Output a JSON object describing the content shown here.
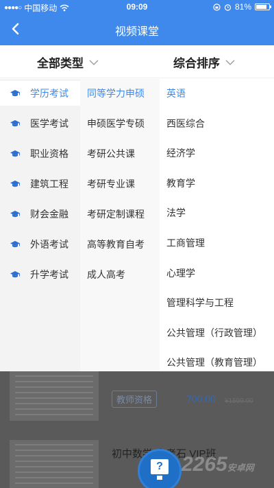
{
  "status_bar": {
    "carrier": "中国移动",
    "time": "09:09",
    "battery": "81%"
  },
  "nav": {
    "title": "视频课堂"
  },
  "filters": {
    "type_label": "全部类型",
    "sort_label": "综合排序"
  },
  "categories": [
    {
      "label": "学历考试",
      "active": true
    },
    {
      "label": "医学考试",
      "active": false
    },
    {
      "label": "职业资格",
      "active": false
    },
    {
      "label": "建筑工程",
      "active": false
    },
    {
      "label": "财会金融",
      "active": false
    },
    {
      "label": "外语考试",
      "active": false
    },
    {
      "label": "升学考试",
      "active": false
    }
  ],
  "subcategories": [
    {
      "label": "同等学力申硕",
      "active": true
    },
    {
      "label": "申硕医学专硕",
      "active": false
    },
    {
      "label": "考研公共课",
      "active": false
    },
    {
      "label": "考研专业课",
      "active": false
    },
    {
      "label": "考研定制课程",
      "active": false
    },
    {
      "label": "高等教育自考",
      "active": false
    },
    {
      "label": "成人高考",
      "active": false
    }
  ],
  "subjects": [
    {
      "label": "英语",
      "active": true
    },
    {
      "label": "西医综合",
      "active": false
    },
    {
      "label": "经济学",
      "active": false
    },
    {
      "label": "教育学",
      "active": false
    },
    {
      "label": "法学",
      "active": false
    },
    {
      "label": "工商管理",
      "active": false
    },
    {
      "label": "心理学",
      "active": false
    },
    {
      "label": "管理科学与工程",
      "active": false
    },
    {
      "label": "公共管理（行政管理）",
      "active": false
    },
    {
      "label": "公共管理（教育管理）",
      "active": false
    }
  ],
  "background_list": {
    "item1": {
      "tag": "教师资格",
      "price": "700.00",
      "old_price": "¥1599.00"
    },
    "item2": {
      "title": "初中数学 中考石 VIP班"
    }
  },
  "watermark": {
    "text": "2265",
    "suffix": "安卓网"
  },
  "colors": {
    "accent": "#3f89ec",
    "nav_bg": "#3f89ec",
    "overlay": "#5a5a5a"
  }
}
